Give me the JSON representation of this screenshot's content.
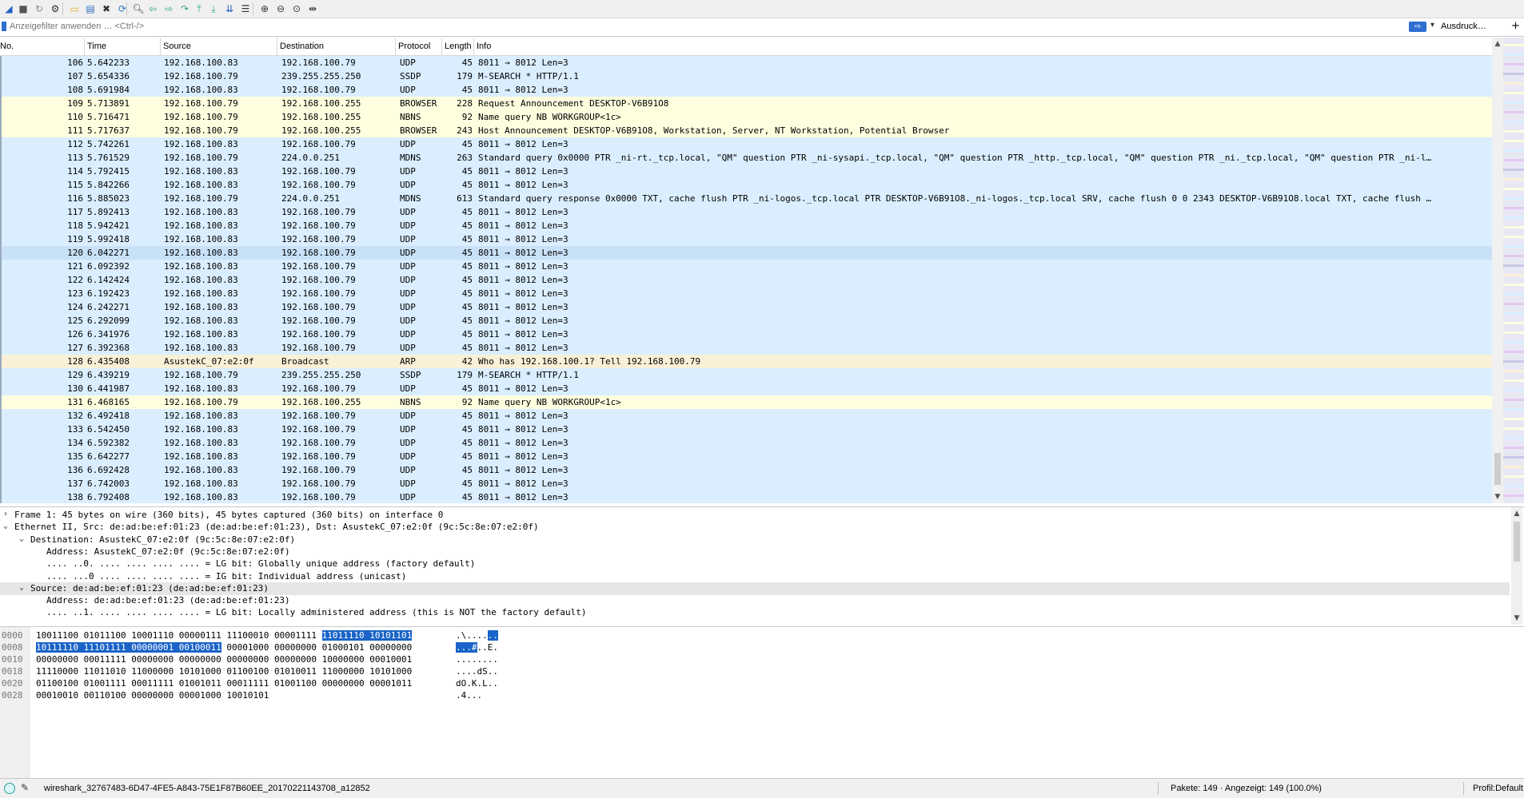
{
  "toolbar": {
    "buttons": [
      "shark-fin-start-icon",
      "stop-icon",
      "restart-icon",
      "options-gear-icon",
      "open-folder-icon",
      "save-file-icon",
      "close-file-icon",
      "reload-icon",
      "find-packet-icon",
      "go-back-icon",
      "go-forward-icon",
      "go-to-packet-icon",
      "first-packet-icon",
      "last-packet-icon",
      "autoscroll-icon",
      "colorize-icon",
      "zoom-in-icon",
      "zoom-out-icon",
      "normal-size-icon",
      "resize-columns-icon"
    ]
  },
  "filter": {
    "placeholder": "Anzeigefilter anwenden … <Ctrl-/>",
    "apply_glyph": "⇨",
    "dropdown_glyph": "▾",
    "expression_label": "Ausdruck…",
    "add_glyph": "+"
  },
  "columns": {
    "no": "No.",
    "time": "Time",
    "source": "Source",
    "destination": "Destination",
    "protocol": "Protocol",
    "length": "Length",
    "info": "Info"
  },
  "colors": {
    "udp": "#daeeff",
    "browser": "#ffffe0",
    "mdns": "#daeeff",
    "arp": "#faf0d7",
    "selected_band": "#c9e1f7",
    "highlight": "#1a63c8"
  },
  "packets": [
    {
      "no": "106",
      "time": "5.642233",
      "src": "192.168.100.83",
      "dst": "192.168.100.79",
      "proto": "UDP",
      "len": "45",
      "info": "8011 → 8012 Len=3",
      "color": "#daeeff"
    },
    {
      "no": "107",
      "time": "5.654336",
      "src": "192.168.100.79",
      "dst": "239.255.255.250",
      "proto": "SSDP",
      "len": "179",
      "info": "M-SEARCH * HTTP/1.1",
      "color": "#daeeff"
    },
    {
      "no": "108",
      "time": "5.691984",
      "src": "192.168.100.83",
      "dst": "192.168.100.79",
      "proto": "UDP",
      "len": "45",
      "info": "8011 → 8012 Len=3",
      "color": "#daeeff"
    },
    {
      "no": "109",
      "time": "5.713891",
      "src": "192.168.100.79",
      "dst": "192.168.100.255",
      "proto": "BROWSER",
      "len": "228",
      "info": "Request Announcement DESKTOP-V6B91O8",
      "color": "#ffffe0"
    },
    {
      "no": "110",
      "time": "5.716471",
      "src": "192.168.100.79",
      "dst": "192.168.100.255",
      "proto": "NBNS",
      "len": "92",
      "info": "Name query NB WORKGROUP<1c>",
      "color": "#ffffe0"
    },
    {
      "no": "111",
      "time": "5.717637",
      "src": "192.168.100.79",
      "dst": "192.168.100.255",
      "proto": "BROWSER",
      "len": "243",
      "info": "Host Announcement DESKTOP-V6B91O8, Workstation, Server, NT Workstation, Potential Browser",
      "color": "#ffffe0"
    },
    {
      "no": "112",
      "time": "5.742261",
      "src": "192.168.100.83",
      "dst": "192.168.100.79",
      "proto": "UDP",
      "len": "45",
      "info": "8011 → 8012 Len=3",
      "color": "#daeeff"
    },
    {
      "no": "113",
      "time": "5.761529",
      "src": "192.168.100.79",
      "dst": "224.0.0.251",
      "proto": "MDNS",
      "len": "263",
      "info": "Standard query 0x0000 PTR _ni-rt._tcp.local, \"QM\" question PTR _ni-sysapi._tcp.local, \"QM\" question PTR _http._tcp.local, \"QM\" question PTR _ni._tcp.local, \"QM\" question PTR _ni-l…",
      "color": "#daeeff"
    },
    {
      "no": "114",
      "time": "5.792415",
      "src": "192.168.100.83",
      "dst": "192.168.100.79",
      "proto": "UDP",
      "len": "45",
      "info": "8011 → 8012 Len=3",
      "color": "#daeeff"
    },
    {
      "no": "115",
      "time": "5.842266",
      "src": "192.168.100.83",
      "dst": "192.168.100.79",
      "proto": "UDP",
      "len": "45",
      "info": "8011 → 8012 Len=3",
      "color": "#daeeff"
    },
    {
      "no": "116",
      "time": "5.885023",
      "src": "192.168.100.79",
      "dst": "224.0.0.251",
      "proto": "MDNS",
      "len": "613",
      "info": "Standard query response 0x0000 TXT, cache flush PTR _ni-logos._tcp.local PTR DESKTOP-V6B91O8._ni-logos._tcp.local SRV, cache flush 0 0 2343 DESKTOP-V6B91O8.local TXT, cache flush …",
      "color": "#daeeff"
    },
    {
      "no": "117",
      "time": "5.892413",
      "src": "192.168.100.83",
      "dst": "192.168.100.79",
      "proto": "UDP",
      "len": "45",
      "info": "8011 → 8012 Len=3",
      "color": "#daeeff"
    },
    {
      "no": "118",
      "time": "5.942421",
      "src": "192.168.100.83",
      "dst": "192.168.100.79",
      "proto": "UDP",
      "len": "45",
      "info": "8011 → 8012 Len=3",
      "color": "#daeeff"
    },
    {
      "no": "119",
      "time": "5.992418",
      "src": "192.168.100.83",
      "dst": "192.168.100.79",
      "proto": "UDP",
      "len": "45",
      "info": "8011 → 8012 Len=3",
      "color": "#daeeff"
    },
    {
      "no": "120",
      "time": "6.042271",
      "src": "192.168.100.83",
      "dst": "192.168.100.79",
      "proto": "UDP",
      "len": "45",
      "info": "8011 → 8012 Len=3",
      "color": "#c9e1f7"
    },
    {
      "no": "121",
      "time": "6.092392",
      "src": "192.168.100.83",
      "dst": "192.168.100.79",
      "proto": "UDP",
      "len": "45",
      "info": "8011 → 8012 Len=3",
      "color": "#daeeff"
    },
    {
      "no": "122",
      "time": "6.142424",
      "src": "192.168.100.83",
      "dst": "192.168.100.79",
      "proto": "UDP",
      "len": "45",
      "info": "8011 → 8012 Len=3",
      "color": "#daeeff"
    },
    {
      "no": "123",
      "time": "6.192423",
      "src": "192.168.100.83",
      "dst": "192.168.100.79",
      "proto": "UDP",
      "len": "45",
      "info": "8011 → 8012 Len=3",
      "color": "#daeeff"
    },
    {
      "no": "124",
      "time": "6.242271",
      "src": "192.168.100.83",
      "dst": "192.168.100.79",
      "proto": "UDP",
      "len": "45",
      "info": "8011 → 8012 Len=3",
      "color": "#daeeff"
    },
    {
      "no": "125",
      "time": "6.292099",
      "src": "192.168.100.83",
      "dst": "192.168.100.79",
      "proto": "UDP",
      "len": "45",
      "info": "8011 → 8012 Len=3",
      "color": "#daeeff"
    },
    {
      "no": "126",
      "time": "6.341976",
      "src": "192.168.100.83",
      "dst": "192.168.100.79",
      "proto": "UDP",
      "len": "45",
      "info": "8011 → 8012 Len=3",
      "color": "#daeeff"
    },
    {
      "no": "127",
      "time": "6.392368",
      "src": "192.168.100.83",
      "dst": "192.168.100.79",
      "proto": "UDP",
      "len": "45",
      "info": "8011 → 8012 Len=3",
      "color": "#daeeff"
    },
    {
      "no": "128",
      "time": "6.435408",
      "src": "AsustekC_07:e2:0f",
      "dst": "Broadcast",
      "proto": "ARP",
      "len": "42",
      "info": "Who has 192.168.100.1? Tell 192.168.100.79",
      "color": "#faf0d7"
    },
    {
      "no": "129",
      "time": "6.439219",
      "src": "192.168.100.79",
      "dst": "239.255.255.250",
      "proto": "SSDP",
      "len": "179",
      "info": "M-SEARCH * HTTP/1.1",
      "color": "#daeeff"
    },
    {
      "no": "130",
      "time": "6.441987",
      "src": "192.168.100.83",
      "dst": "192.168.100.79",
      "proto": "UDP",
      "len": "45",
      "info": "8011 → 8012 Len=3",
      "color": "#daeeff"
    },
    {
      "no": "131",
      "time": "6.468165",
      "src": "192.168.100.79",
      "dst": "192.168.100.255",
      "proto": "NBNS",
      "len": "92",
      "info": "Name query NB WORKGROUP<1c>",
      "color": "#ffffe0"
    },
    {
      "no": "132",
      "time": "6.492418",
      "src": "192.168.100.83",
      "dst": "192.168.100.79",
      "proto": "UDP",
      "len": "45",
      "info": "8011 → 8012 Len=3",
      "color": "#daeeff"
    },
    {
      "no": "133",
      "time": "6.542450",
      "src": "192.168.100.83",
      "dst": "192.168.100.79",
      "proto": "UDP",
      "len": "45",
      "info": "8011 → 8012 Len=3",
      "color": "#daeeff"
    },
    {
      "no": "134",
      "time": "6.592382",
      "src": "192.168.100.83",
      "dst": "192.168.100.79",
      "proto": "UDP",
      "len": "45",
      "info": "8011 → 8012 Len=3",
      "color": "#daeeff"
    },
    {
      "no": "135",
      "time": "6.642277",
      "src": "192.168.100.83",
      "dst": "192.168.100.79",
      "proto": "UDP",
      "len": "45",
      "info": "8011 → 8012 Len=3",
      "color": "#daeeff"
    },
    {
      "no": "136",
      "time": "6.692428",
      "src": "192.168.100.83",
      "dst": "192.168.100.79",
      "proto": "UDP",
      "len": "45",
      "info": "8011 → 8012 Len=3",
      "color": "#daeeff"
    },
    {
      "no": "137",
      "time": "6.742003",
      "src": "192.168.100.83",
      "dst": "192.168.100.79",
      "proto": "UDP",
      "len": "45",
      "info": "8011 → 8012 Len=3",
      "color": "#daeeff"
    },
    {
      "no": "138",
      "time": "6.792408",
      "src": "192.168.100.83",
      "dst": "192.168.100.79",
      "proto": "UDP",
      "len": "45",
      "info": "8011 → 8012 Len=3",
      "color": "#daeeff"
    }
  ],
  "details": [
    {
      "indent": 0,
      "chev": "›",
      "text": "Frame 1: 45 bytes on wire (360 bits), 45 bytes captured (360 bits) on interface 0",
      "selected": false
    },
    {
      "indent": 0,
      "chev": "⌄",
      "text": "Ethernet II, Src: de:ad:be:ef:01:23 (de:ad:be:ef:01:23), Dst: AsustekC_07:e2:0f (9c:5c:8e:07:e2:0f)",
      "selected": false
    },
    {
      "indent": 1,
      "chev": "⌄",
      "text": "Destination: AsustekC_07:e2:0f (9c:5c:8e:07:e2:0f)",
      "selected": false
    },
    {
      "indent": 2,
      "chev": "",
      "text": "Address: AsustekC_07:e2:0f (9c:5c:8e:07:e2:0f)",
      "selected": false
    },
    {
      "indent": 2,
      "chev": "",
      "text": ".... ..0. .... .... .... .... = LG bit: Globally unique address (factory default)",
      "selected": false
    },
    {
      "indent": 2,
      "chev": "",
      "text": ".... ...0 .... .... .... .... = IG bit: Individual address (unicast)",
      "selected": false
    },
    {
      "indent": 1,
      "chev": "⌄",
      "text": "Source: de:ad:be:ef:01:23 (de:ad:be:ef:01:23)",
      "selected": true
    },
    {
      "indent": 2,
      "chev": "",
      "text": "Address: de:ad:be:ef:01:23 (de:ad:be:ef:01:23)",
      "selected": false
    },
    {
      "indent": 2,
      "chev": "",
      "text": ".... ..1. .... .... .... .... = LG bit: Locally administered address (this is NOT the factory default)",
      "selected": false
    }
  ],
  "bytes": [
    {
      "offset": "0000",
      "pre": "10011100 01011100 10001110 00000111 11100010 00001111 ",
      "hl": "11011110 10101101",
      "post": "",
      "ascii_pre": ".\\....",
      "ascii_hl": "..",
      "ascii_post": ""
    },
    {
      "offset": "0008",
      "pre": "",
      "hl": "10111110 11101111 00000001 00100011",
      "post": " 00001000 00000000 01000101 00000000",
      "ascii_pre": "",
      "ascii_hl": "...#",
      "ascii_post": "..E."
    },
    {
      "offset": "0010",
      "pre": "00000000 00011111 00000000 00000000 00000000 00000000 10000000 00010001",
      "hl": "",
      "post": "",
      "ascii_pre": "........",
      "ascii_hl": "",
      "ascii_post": ""
    },
    {
      "offset": "0018",
      "pre": "11110000 11011010 11000000 10101000 01100100 01010011 11000000 10101000",
      "hl": "",
      "post": "",
      "ascii_pre": "....dS..",
      "ascii_hl": "",
      "ascii_post": ""
    },
    {
      "offset": "0020",
      "pre": "01100100 01001111 00011111 01001011 00011111 01001100 00000000 00001011",
      "hl": "",
      "post": "",
      "ascii_pre": "dO.K.L..",
      "ascii_hl": "",
      "ascii_post": ""
    },
    {
      "offset": "0028",
      "pre": "00010010 00110100 00000000 00001000 10010101",
      "hl": "",
      "post": "",
      "ascii_pre": ".4...",
      "ascii_hl": "",
      "ascii_post": ""
    }
  ],
  "status": {
    "file": "wireshark_32767483-6D47-4FE5-A843-75E1F87B60EE_20170221143708_a12852",
    "packets": "Pakete: 149 · Angezeigt: 149 (100.0%)",
    "profile": "Profil:Default"
  }
}
